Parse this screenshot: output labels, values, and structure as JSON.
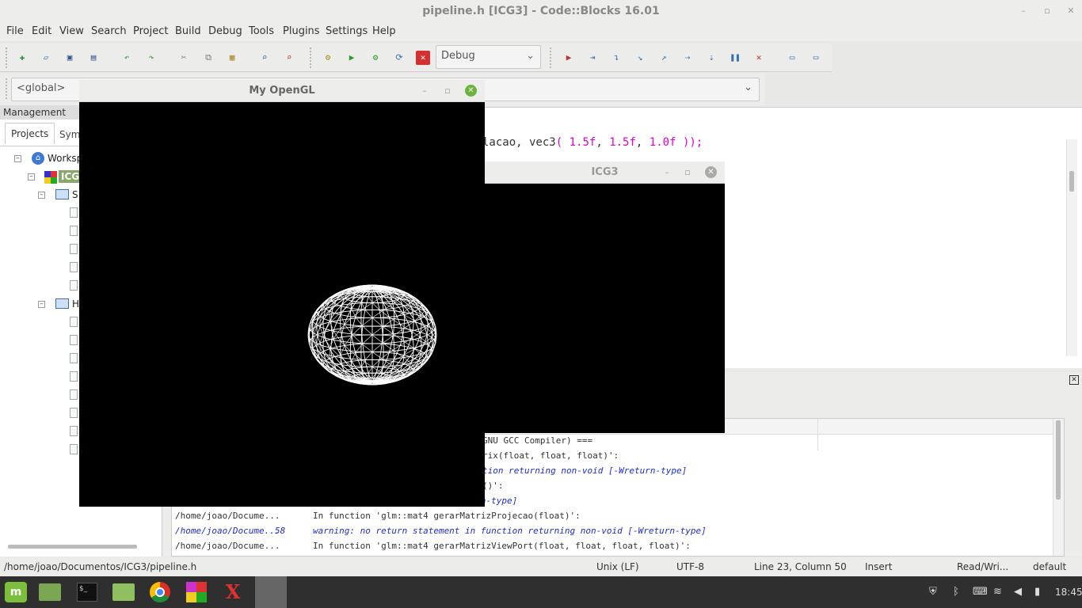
{
  "window": {
    "title": "pipeline.h [ICG3] - Code::Blocks 16.01"
  },
  "menu": [
    "File",
    "Edit",
    "View",
    "Search",
    "Project",
    "Build",
    "Debug",
    "Tools",
    "Plugins",
    "Settings",
    "Help"
  ],
  "toolbar": {
    "build_target": "Debug",
    "scope": "<global>"
  },
  "management": {
    "title": "Management",
    "tabs": [
      "Projects",
      "Sym"
    ],
    "tree": {
      "workspace": "Worksp",
      "project": "ICG3",
      "sources": "S",
      "headers": "H"
    }
  },
  "editor": {
    "code_line": {
      "prefix": "lacao, vec3",
      "paren_open": "(",
      "arg1": "1.5f",
      "comma1": ",",
      "arg2": "1.5f",
      "comma2": ",",
      "arg3": "1.0f",
      "paren_close": "));"
    }
  },
  "opengl_window": {
    "title": "My OpenGL"
  },
  "icg3_window": {
    "title": "ICG3"
  },
  "build_log": {
    "rows": [
      {
        "file": "",
        "line": "",
        "message": "GNU GCC Compiler) ===",
        "warn": false
      },
      {
        "file": "",
        "line": "",
        "message": "rix(float, float, float)':",
        "warn": false
      },
      {
        "file": "",
        "line": "",
        "message": "tion returning non-void [-Wreturn-type]",
        "warn": true
      },
      {
        "file": "",
        "line": "",
        "message": "()':",
        "warn": false
      },
      {
        "file": "/home/joao/Docume...",
        "line": "",
        "message": "tion returning non-void [-Wreturn-type]",
        "warn": true
      },
      {
        "file": "/home/joao/Docume...",
        "line": "",
        "message": "In function 'glm::mat4 gerarMatrizProjecao(float)':",
        "warn": false
      },
      {
        "file": "/home/joao/Docume...",
        "line": "58",
        "message": "warning: no return statement in function returning non-void [-Wreturn-type]",
        "warn": true
      },
      {
        "file": "/home/joao/Docume...",
        "line": "",
        "message": "In function 'glm::mat4 gerarMatrizViewPort(float, float, float, float)':",
        "warn": false
      }
    ]
  },
  "status": {
    "path": "/home/joao/Documentos/ICG3/pipeline.h",
    "eol": "Unix (LF)",
    "encoding": "UTF-8",
    "position": "Line 23, Column 50",
    "mode": "Insert",
    "access": "Read/Wri...",
    "profile": "default"
  },
  "taskbar": {
    "clock": "18:45"
  },
  "colors": {
    "code_number": "#e000d0",
    "warning": "#1f2ccf",
    "taskbar_bg": "#2f2f2f",
    "mint_green": "#7dbe3c"
  }
}
